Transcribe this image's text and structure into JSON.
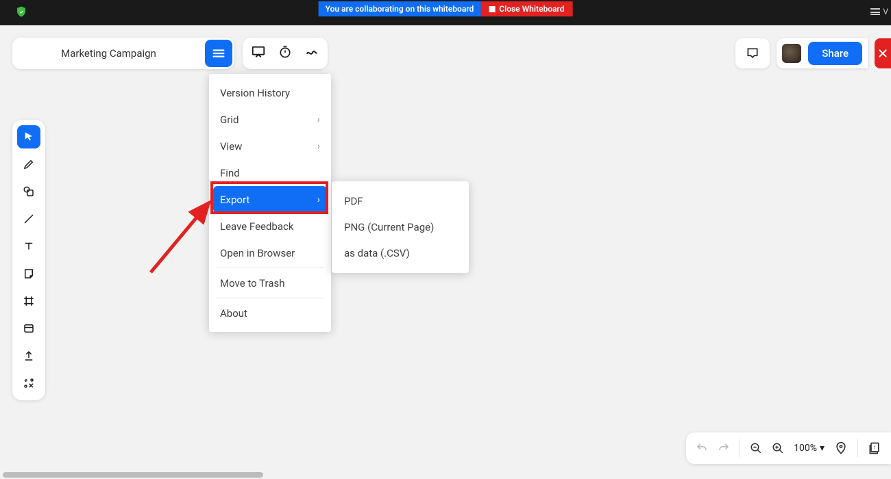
{
  "topbar": {
    "collab_text": "You are collaborating on this whiteboard",
    "close_text": "Close Whiteboard",
    "v_label": "V"
  },
  "title": "Marketing Campaign",
  "share_label": "Share",
  "menu": {
    "version_history": "Version History",
    "grid": "Grid",
    "view": "View",
    "find": "Find",
    "export": "Export",
    "leave_feedback": "Leave Feedback",
    "open_browser": "Open in Browser",
    "move_trash": "Move to Trash",
    "about": "About"
  },
  "export_submenu": {
    "pdf": "PDF",
    "png": "PNG (Current Page)",
    "csv": "as data (.CSV)"
  },
  "zoom": "100%",
  "icons": {
    "cursor": "cursor",
    "pen": "pen",
    "shapes": "shapes",
    "line": "line",
    "text": "text",
    "note": "note",
    "frame": "frame",
    "table": "table",
    "upload": "upload",
    "magic": "magic"
  }
}
